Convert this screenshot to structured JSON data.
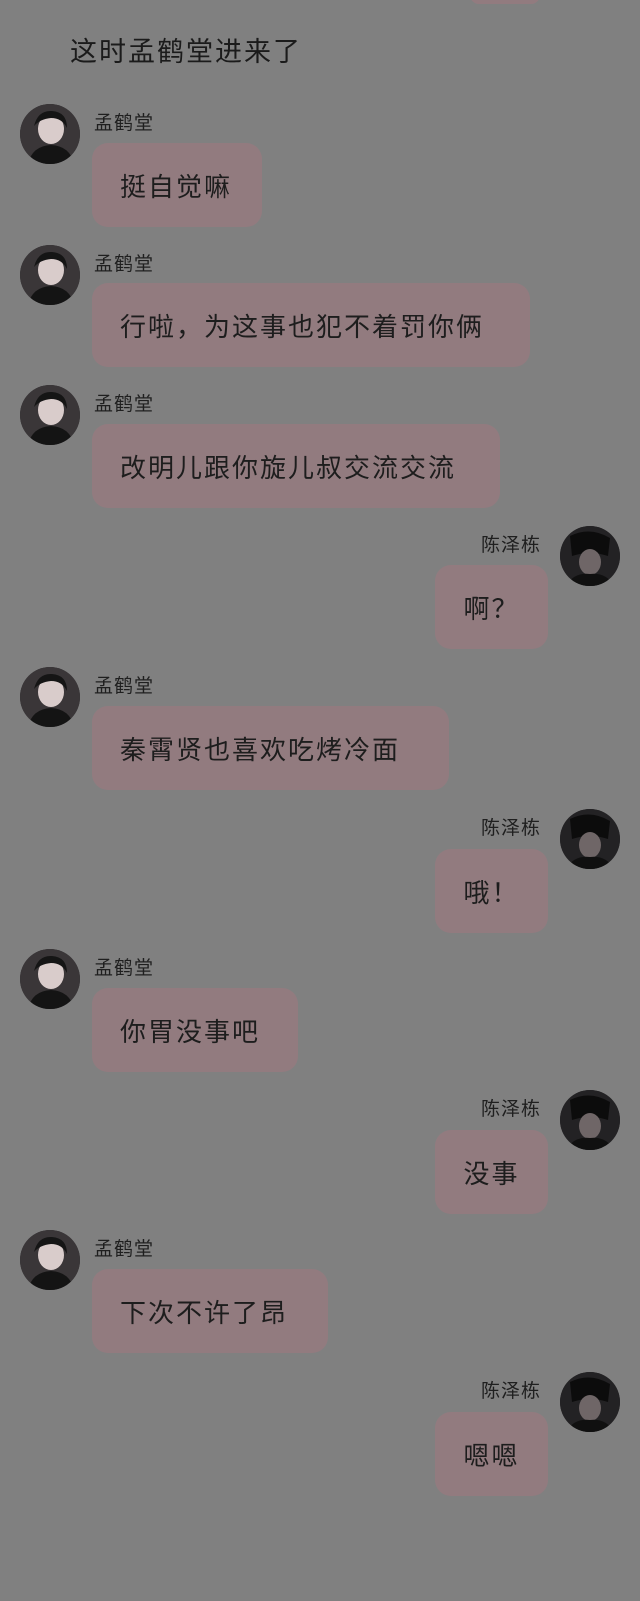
{
  "narration": "这时孟鹤堂进来了",
  "names": {
    "left": "孟鹤堂",
    "right": "陈泽栋"
  },
  "messages": [
    {
      "side": "left",
      "text": "挺自觉嘛"
    },
    {
      "side": "left",
      "text": "行啦，为这事也犯不着罚你俩"
    },
    {
      "side": "left",
      "text": "改明儿跟你旋儿叔交流交流"
    },
    {
      "side": "right",
      "text": "啊？"
    },
    {
      "side": "left",
      "text": "秦霄贤也喜欢吃烤冷面"
    },
    {
      "side": "right",
      "text": "哦！"
    },
    {
      "side": "left",
      "text": "你胃没事吧"
    },
    {
      "side": "right",
      "text": "没事"
    },
    {
      "side": "left",
      "text": "下次不许了昂"
    },
    {
      "side": "right",
      "text": "嗯嗯"
    }
  ],
  "colors": {
    "background": "#808080",
    "bubble": "#927b7f"
  }
}
